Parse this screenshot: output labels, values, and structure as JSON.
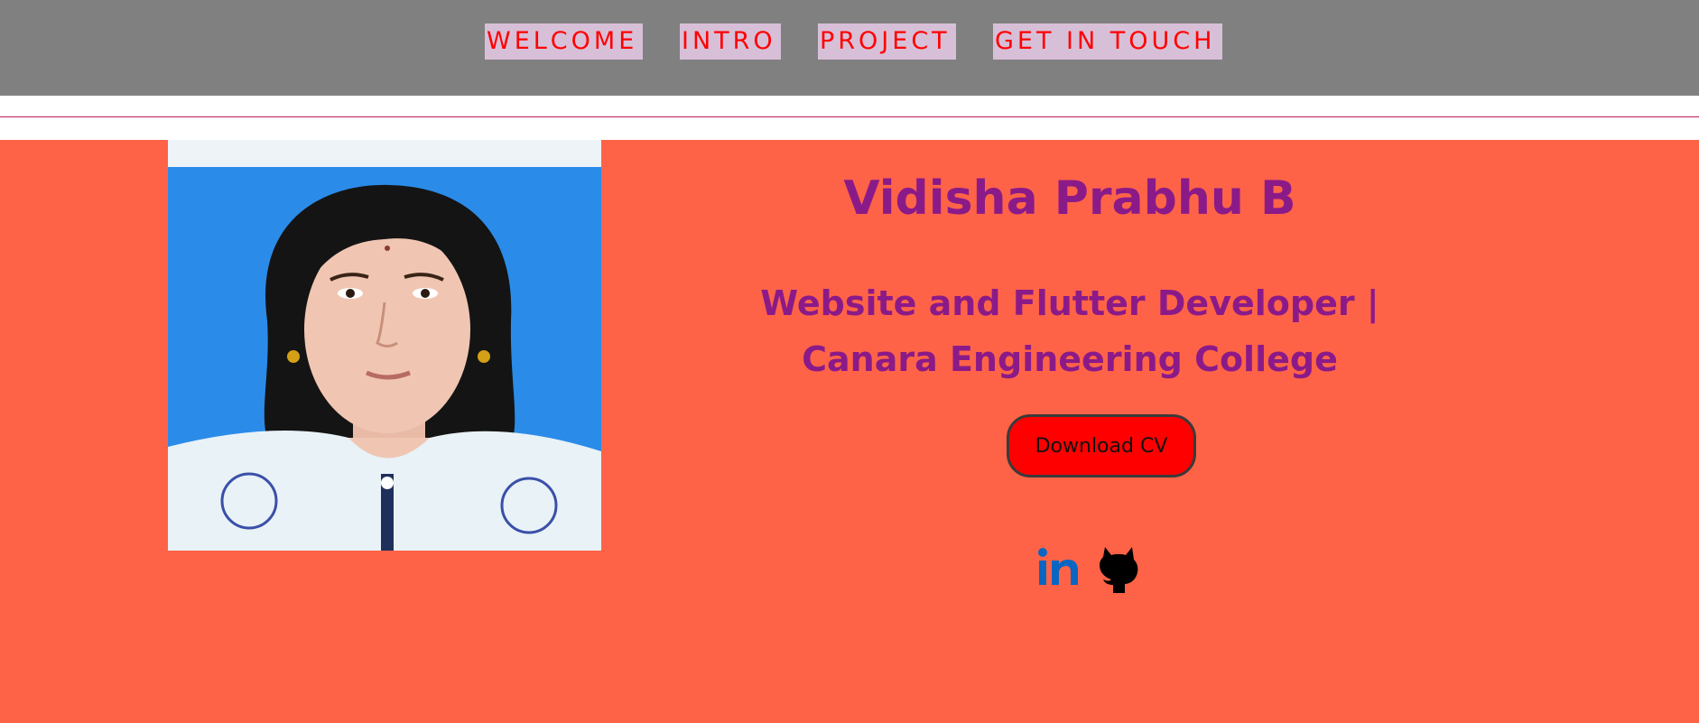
{
  "nav": {
    "items": [
      {
        "label": "WELCOME"
      },
      {
        "label": "INTRO"
      },
      {
        "label": "PROJECT"
      },
      {
        "label": "GET IN TOUCH"
      }
    ]
  },
  "hero": {
    "name": "Vidisha Prabhu B",
    "role_line1": "Website and Flutter Developer |",
    "role_line2": "Canara Engineering College",
    "cv_button_label": "Download CV",
    "photo_alt": "profile-photo",
    "social": [
      {
        "icon": "linkedin-icon"
      },
      {
        "icon": "github-icon"
      }
    ]
  },
  "colors": {
    "nav_bg": "#808080",
    "nav_link_bg": "#d8bfd8",
    "nav_link_text": "#ff0000",
    "hero_bg": "#ff6347",
    "heading_text": "#8b1a89",
    "cv_button_bg": "#ff0000",
    "linkedin": "#0a66c2"
  }
}
